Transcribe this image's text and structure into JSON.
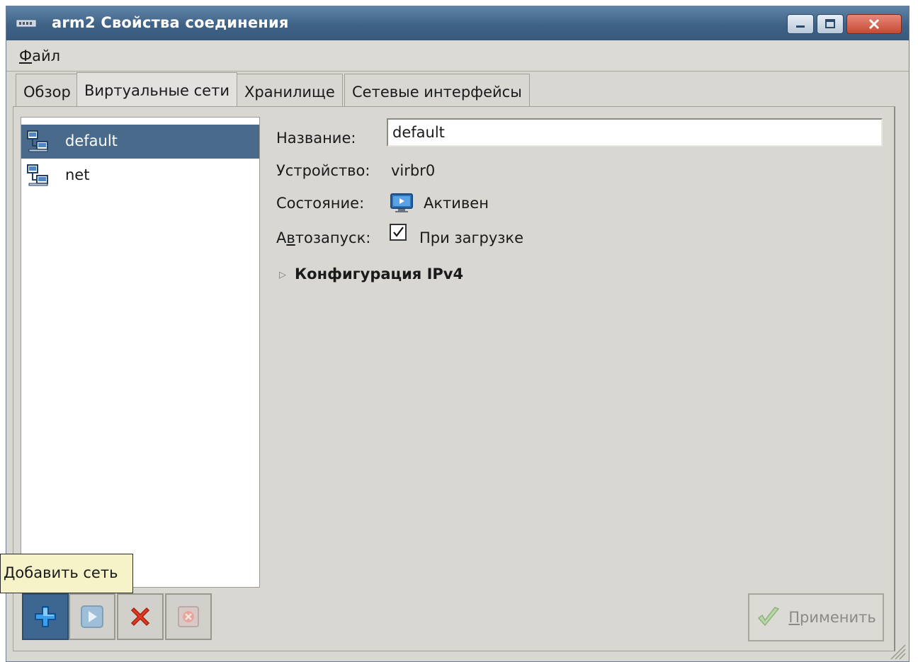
{
  "window": {
    "title": "arm2 Свойства соединения"
  },
  "menu": {
    "file_hotkey": "Ф",
    "file_rest": "айл"
  },
  "tabs": [
    {
      "label": "Обзор"
    },
    {
      "label": "Виртуальные сети"
    },
    {
      "label": "Хранилище"
    },
    {
      "label": "Сетевые интерфейсы"
    }
  ],
  "networks": [
    {
      "name": "default",
      "selected": true
    },
    {
      "name": "net",
      "selected": false
    }
  ],
  "details": {
    "name_label": "Название:",
    "name_value": "default",
    "device_label": "Устройство:",
    "device_value": "virbr0",
    "state_label": "Состояние:",
    "state_value": "Активен",
    "autostart_label_pre": "А",
    "autostart_label_hotkey": "в",
    "autostart_label_post": "тозапуск:",
    "autostart_value": "При загрузке",
    "autostart_checked": true,
    "ipv4_section": "Конфигурация IPv4"
  },
  "toolbar": {
    "add_tooltip": "Добавить сеть",
    "apply_hotkey": "П",
    "apply_rest": "рименить"
  },
  "colors": {
    "selection": "#4a6a8b",
    "titlebar": "#3f6386",
    "tooltip_bg": "#f7f3c8"
  },
  "icons": {
    "network": "network-icon",
    "state": "monitor-active-icon",
    "add": "plus-icon",
    "start": "play-icon",
    "stop": "red-x-icon",
    "delete": "delete-icon",
    "apply": "checkmark-icon"
  }
}
